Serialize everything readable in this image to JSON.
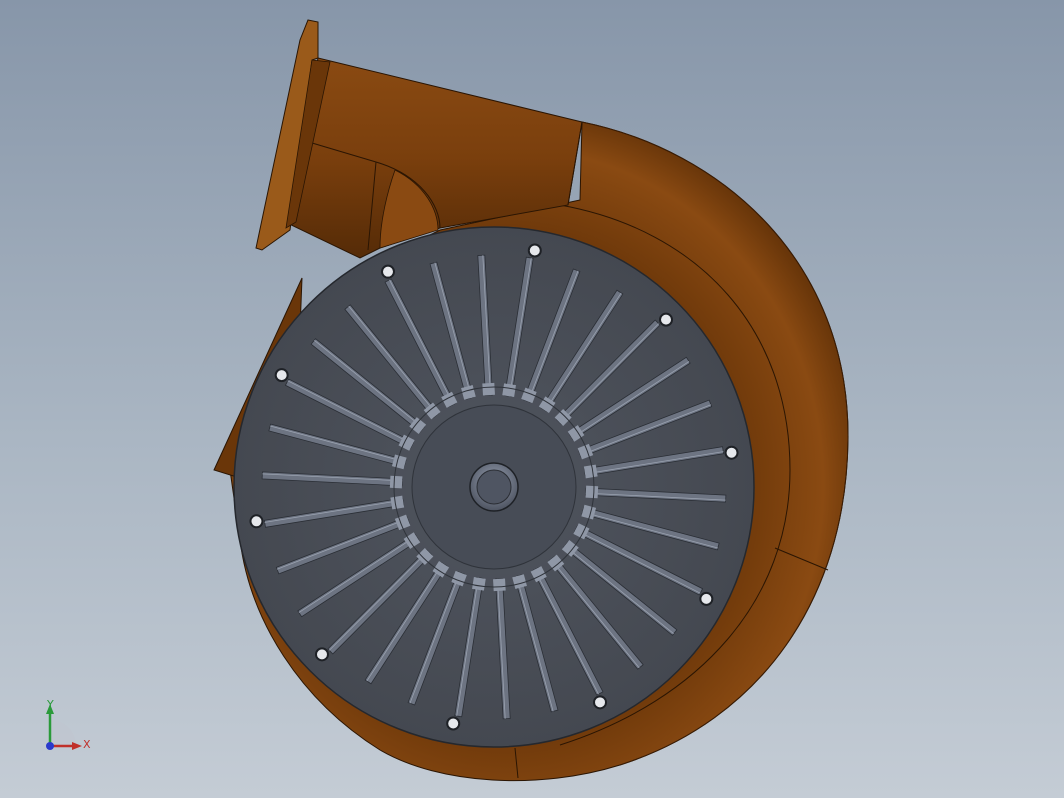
{
  "viewport": {
    "background_top": "#8796a9",
    "background_bottom": "#c4ccd5"
  },
  "model": {
    "housing_color": "#7a3f0d",
    "housing_shadow": "#4a2405",
    "plate_color": "#4a4f5a",
    "blade_count": 30,
    "bolt_count": 10
  },
  "triad": {
    "x_label": "X",
    "y_label": "Y",
    "x_color": "#c0302a",
    "y_color": "#2a9a3a",
    "z_color": "#2a3acc"
  }
}
